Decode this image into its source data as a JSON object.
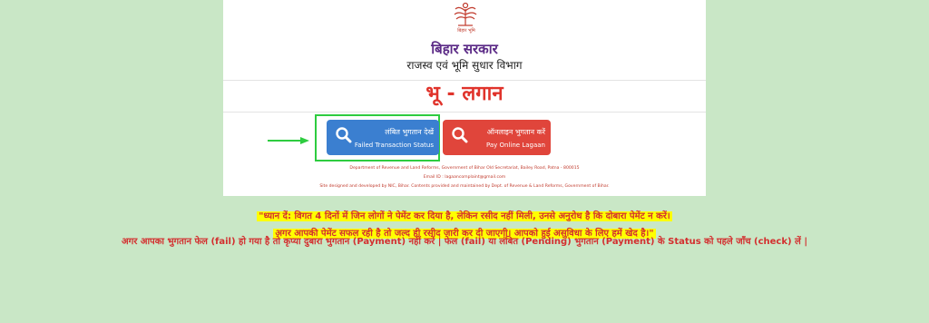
{
  "header": {
    "emblem_caption": "बिहार भूमि",
    "gov_title": "बिहार सरकार",
    "dept_title": "राजस्व एवं भूमि सुधार विभाग",
    "main_title": "भू - लगान"
  },
  "buttons": {
    "failed_status": {
      "line1": "लंबित भुगतान देखें",
      "line2": "Failed Transaction Status",
      "icon": "search-icon"
    },
    "pay_online": {
      "line1": "ऑनलाइन भुगतान करें",
      "line2": "Pay Online Lagaan",
      "icon": "search-icon"
    }
  },
  "footer": {
    "line1": "Department of Revenue and Land Reforms, Government of Bihar Old Secretariat, Bailey Road, Patna - 800015",
    "line2": "Email ID : lagaancomplaint@gmail.com",
    "line3": "Site designed and developed by NIC, Bihar. Contents provided and maintained by Dept. of Revenue & Land Reforms, Government of Bihar."
  },
  "notice": {
    "line1": "\"ध्यान दें: विगत 4 दिनों में जिन लोगों ने पेमेंट कर दिया है, लेकिन रसीद नहीं मिली, उनसे अनुरोध है कि दोबारा पेमेंट न करें।",
    "line2": "अगर आपकी पेमेंट सफल रही है तो जल्द ही रसीद जारी कर दी जाएगी। आपको हुई असुविधा के लिए हमें खेद है।\""
  },
  "warning": "अगर आपका भुगतान फेल (fail) हो गया है तो कृप्या दुबारा भुगतान (Payment) नहीं करें | फेल (fail) या लंबित (Pending) भुगतान (Payment) के Status को पहले जाँच (check) लें |",
  "colors": {
    "background": "#c9e7c6",
    "blue_button": "#3b7fd0",
    "red_button": "#e0453b",
    "title_red": "#e0332b",
    "highlight_green": "#2ecc40",
    "notice_yellow": "#ffff00"
  }
}
